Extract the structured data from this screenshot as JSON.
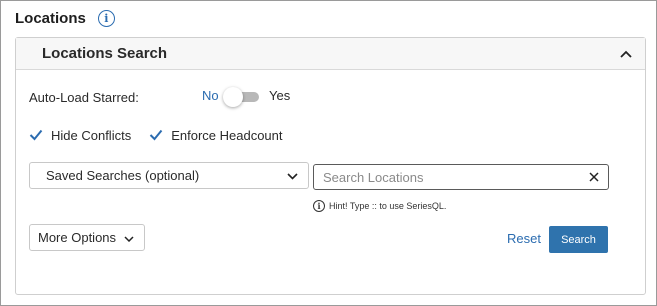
{
  "page": {
    "title": "Locations",
    "info_icon": "info-circle-icon"
  },
  "panel": {
    "title": "Locations Search",
    "collapse_icon": "chevron-up-icon"
  },
  "autoload": {
    "label": "Auto-Load Starred:",
    "no_label": "No",
    "yes_label": "Yes",
    "value": "No"
  },
  "checkboxes": [
    {
      "label": "Hide Conflicts",
      "checked": true
    },
    {
      "label": "Enforce Headcount",
      "checked": true
    }
  ],
  "saved_searches": {
    "label": "Saved Searches (optional)",
    "icon": "chevron-down-icon"
  },
  "search": {
    "placeholder": "Search Locations",
    "value": "",
    "clear_icon": "close-icon",
    "hint": "Hint! Type :: to use SeriesQL."
  },
  "more_options": {
    "label": "More Options",
    "icon": "chevron-down-icon"
  },
  "actions": {
    "reset_label": "Reset",
    "search_label": "Search"
  },
  "colors": {
    "accent": "#2b6cb0",
    "button_bg": "#2f73ad",
    "check_color": "#2b6cb0"
  }
}
